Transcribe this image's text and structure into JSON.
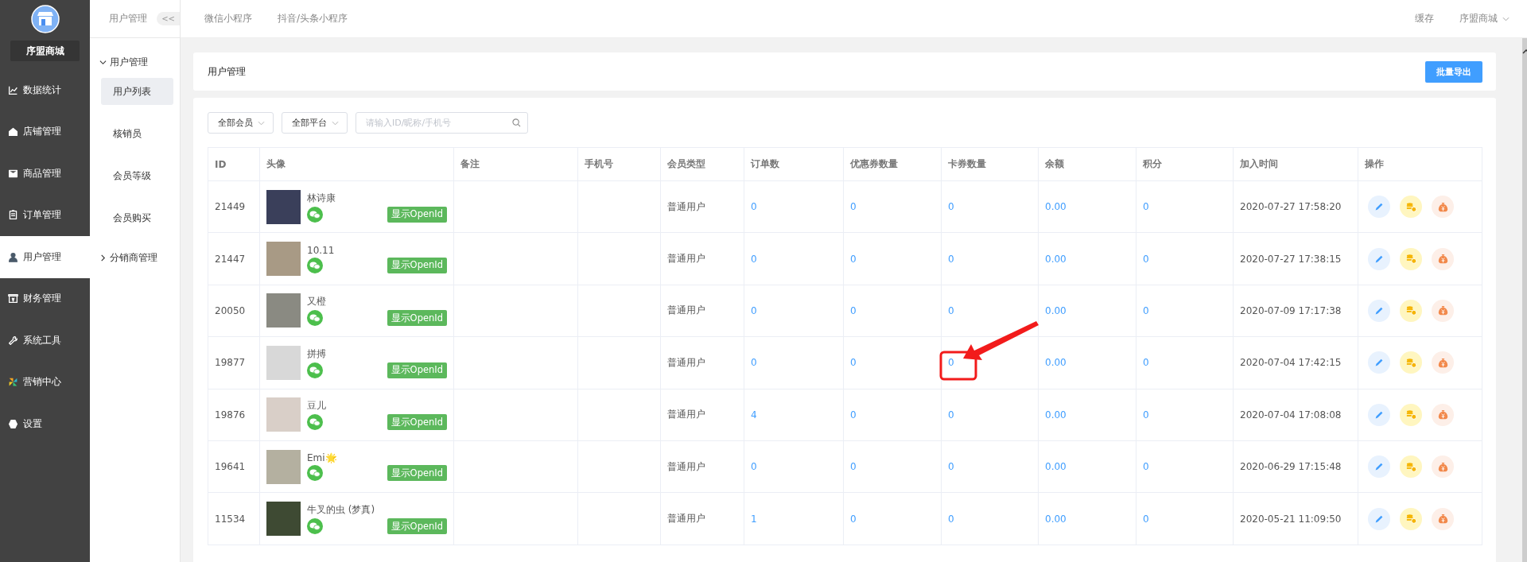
{
  "sidebar": {
    "store_name": "序盟商城",
    "items": [
      {
        "label": "数据统计",
        "selected": false
      },
      {
        "label": "店铺管理",
        "selected": false
      },
      {
        "label": "商品管理",
        "selected": false
      },
      {
        "label": "订单管理",
        "selected": false
      },
      {
        "label": "用户管理",
        "selected": true
      },
      {
        "label": "财务管理",
        "selected": false
      },
      {
        "label": "系统工具",
        "selected": false
      },
      {
        "label": "营销中心",
        "selected": false
      },
      {
        "label": "设置",
        "selected": false
      }
    ]
  },
  "submenu": {
    "title": "用户管理",
    "collapse": "<<",
    "groups": [
      {
        "label": "用户管理",
        "expanded": true,
        "children": [
          {
            "label": "用户列表",
            "selected": true
          },
          {
            "label": "核销员",
            "selected": false
          },
          {
            "label": "会员等级",
            "selected": false
          },
          {
            "label": "会员购买",
            "selected": false
          }
        ]
      },
      {
        "label": "分销商管理",
        "expanded": false
      }
    ]
  },
  "top_tabs": [
    "微信小程序",
    "抖音/头条小程序"
  ],
  "top_right": {
    "cache": "缓存",
    "account": "序盟商城"
  },
  "page_header": {
    "title": "用户管理",
    "export_button": "批量导出"
  },
  "filters": {
    "member_select": "全部会员",
    "platform_select": "全部平台",
    "search": {
      "placeholder": "请输入ID/昵称/手机号"
    }
  },
  "table": {
    "columns": [
      "ID",
      "头像",
      "备注",
      "手机号",
      "会员类型",
      "订单数",
      "优惠券数量",
      "卡券数量",
      "余额",
      "积分",
      "加入时间",
      "操作"
    ],
    "rows": [
      {
        "id": "21449",
        "nickname": "林诗康",
        "openid_button": "显示OpenId",
        "member_type": "普通用户",
        "orders": "0",
        "coupons": "0",
        "cards": "0",
        "balance": "0.00",
        "points": "0",
        "joined": "2020-07-27 17:58:20"
      },
      {
        "id": "21447",
        "nickname": "10.11",
        "openid_button": "显示OpenId",
        "member_type": "普通用户",
        "orders": "0",
        "coupons": "0",
        "cards": "0",
        "balance": "0.00",
        "points": "0",
        "joined": "2020-07-27 17:38:15"
      },
      {
        "id": "20050",
        "nickname": "又橙",
        "openid_button": "显示OpenId",
        "member_type": "普通用户",
        "orders": "0",
        "coupons": "0",
        "cards": "0",
        "balance": "0.00",
        "points": "0",
        "joined": "2020-07-09 17:17:38"
      },
      {
        "id": "19877",
        "nickname": "拼搏",
        "openid_button": "显示OpenId",
        "member_type": "普通用户",
        "orders": "0",
        "coupons": "0",
        "cards": "0",
        "balance": "0.00",
        "points": "0",
        "joined": "2020-07-04 17:42:15"
      },
      {
        "id": "19876",
        "nickname": "豆儿",
        "openid_button": "显示OpenId",
        "member_type": "普通用户",
        "orders": "4",
        "coupons": "0",
        "cards": "0",
        "balance": "0.00",
        "points": "0",
        "joined": "2020-07-04 17:08:08"
      },
      {
        "id": "19641",
        "nickname": "Emi🌟",
        "openid_button": "显示OpenId",
        "member_type": "普通用户",
        "orders": "0",
        "coupons": "0",
        "cards": "0",
        "balance": "0.00",
        "points": "0",
        "joined": "2020-06-29 17:15:48"
      },
      {
        "id": "11534",
        "nickname": "牛叉的虫 (梦真)",
        "openid_button": "显示OpenId",
        "member_type": "普通用户",
        "orders": "1",
        "coupons": "0",
        "cards": "0",
        "balance": "0.00",
        "points": "0",
        "joined": "2020-05-21 11:09:50"
      }
    ]
  }
}
